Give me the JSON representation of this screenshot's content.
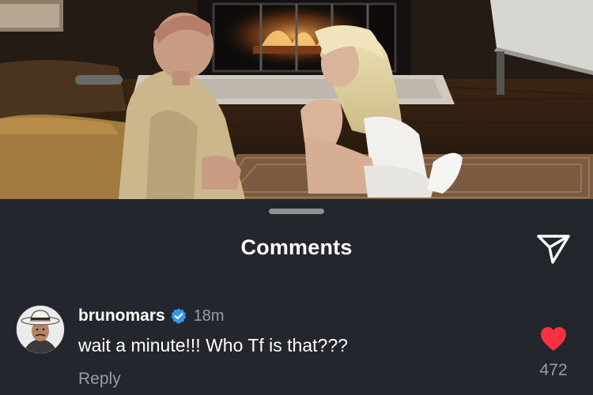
{
  "video": {
    "description_icon": "video-frame"
  },
  "sheet": {
    "title": "Comments",
    "share_icon": "send-icon"
  },
  "comment": {
    "username": "brunomars",
    "verified": true,
    "time": "18m",
    "text": "wait a minute!!! Who Tf is that???",
    "reply_label": "Reply",
    "like_count": "472",
    "liked": true
  },
  "colors": {
    "sheet_bg": "#23262d",
    "text_primary": "#ffffff",
    "text_secondary": "#9a9ca3",
    "verified_blue": "#3797f0",
    "heart_red": "#ff3040"
  }
}
